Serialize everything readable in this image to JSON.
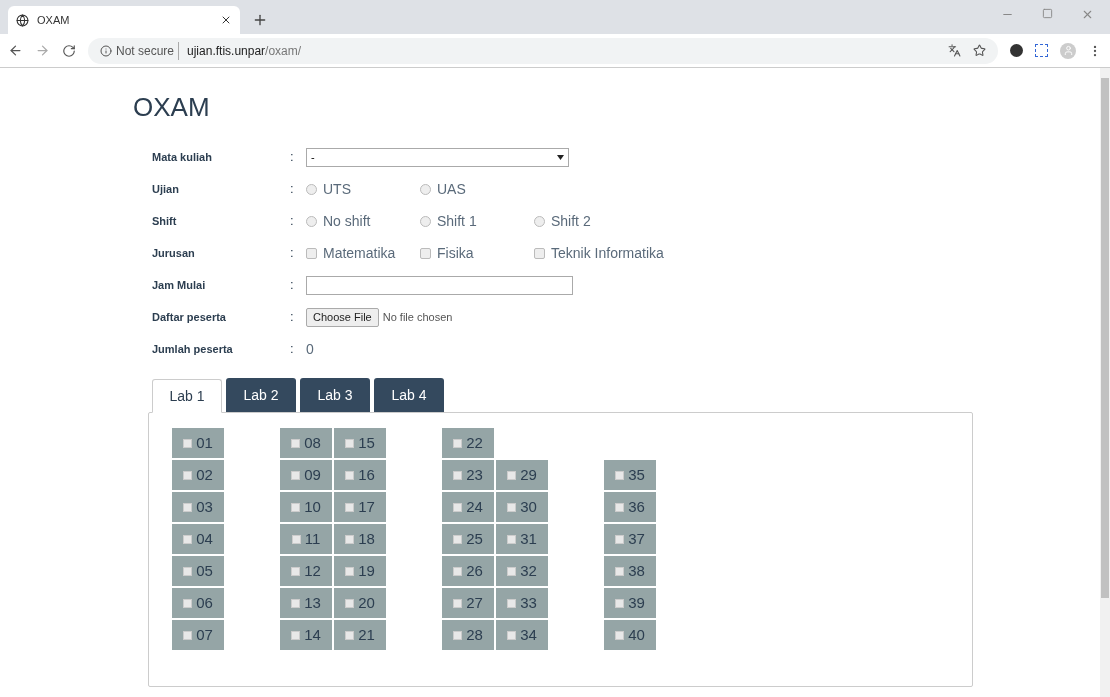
{
  "browser": {
    "tab_title": "OXAM",
    "security": "Not secure",
    "url_host": "ujian.ftis.unpar",
    "url_path": "/oxam/"
  },
  "page": {
    "title": "OXAM",
    "form": [
      {
        "kind": "select",
        "label": "Mata kuliah",
        "colon": ":",
        "value": "-"
      },
      {
        "kind": "radio",
        "label": "Ujian",
        "colon": ":",
        "options": [
          {
            "label": "UTS",
            "selected": false
          },
          {
            "label": "UAS",
            "selected": false
          }
        ]
      },
      {
        "kind": "radio",
        "label": "Shift",
        "colon": ":",
        "options": [
          {
            "label": "No shift",
            "selected": false
          },
          {
            "label": "Shift 1",
            "selected": false
          },
          {
            "label": "Shift 2",
            "selected": false
          }
        ]
      },
      {
        "kind": "checkbox",
        "label": "Jurusan",
        "colon": ":",
        "options": [
          {
            "label": "Matematika",
            "checked": false
          },
          {
            "label": "Fisika",
            "checked": false
          },
          {
            "label": "Teknik Informatika",
            "checked": false
          }
        ]
      },
      {
        "kind": "text",
        "label": "Jam Mulai",
        "colon": ":"
      },
      {
        "kind": "file",
        "label": "Daftar peserta",
        "colon": ":",
        "button": "Choose File",
        "status": "No file chosen"
      },
      {
        "kind": "value",
        "label": "Jumlah peserta",
        "colon": ":",
        "value": "0"
      }
    ],
    "tabs": [
      {
        "label": "Lab 1",
        "selected": true
      },
      {
        "label": "Lab 2",
        "selected": false
      },
      {
        "label": "Lab 3",
        "selected": false
      },
      {
        "label": "Lab 4",
        "selected": false
      }
    ],
    "seat_groups": [
      {
        "columns": [
          {
            "seats": [
              {
                "label": "01",
                "checked": false
              },
              {
                "label": "02",
                "checked": false
              },
              {
                "label": "03",
                "checked": false
              },
              {
                "label": "04",
                "checked": false
              },
              {
                "label": "05",
                "checked": false
              },
              {
                "label": "06",
                "checked": false
              },
              {
                "label": "07",
                "checked": false
              }
            ]
          }
        ]
      },
      {
        "columns": [
          {
            "seats": [
              {
                "label": "08",
                "checked": false
              },
              {
                "label": "09",
                "checked": false
              },
              {
                "label": "10",
                "checked": false
              },
              {
                "label": "11",
                "checked": false
              },
              {
                "label": "12",
                "checked": false
              },
              {
                "label": "13",
                "checked": false
              },
              {
                "label": "14",
                "checked": false
              }
            ]
          },
          {
            "seats": [
              {
                "label": "15",
                "checked": false
              },
              {
                "label": "16",
                "checked": false
              },
              {
                "label": "17",
                "checked": false
              },
              {
                "label": "18",
                "checked": false
              },
              {
                "label": "19",
                "checked": false
              },
              {
                "label": "20",
                "checked": false
              },
              {
                "label": "21",
                "checked": false
              }
            ]
          }
        ]
      },
      {
        "columns": [
          {
            "seats": [
              {
                "label": "22",
                "checked": false
              },
              {
                "label": "23",
                "checked": false
              },
              {
                "label": "24",
                "checked": false
              },
              {
                "label": "25",
                "checked": false
              },
              {
                "label": "26",
                "checked": false
              },
              {
                "label": "27",
                "checked": false
              },
              {
                "label": "28",
                "checked": false
              }
            ]
          },
          {
            "seats": [
              {
                "label": "29",
                "checked": false
              },
              {
                "label": "30",
                "checked": false
              },
              {
                "label": "31",
                "checked": false
              },
              {
                "label": "32",
                "checked": false
              },
              {
                "label": "33",
                "checked": false
              },
              {
                "label": "34",
                "checked": false
              }
            ]
          }
        ]
      },
      {
        "columns": [
          {
            "seats": [
              {
                "label": "35",
                "checked": false
              },
              {
                "label": "36",
                "checked": false
              },
              {
                "label": "37",
                "checked": false
              },
              {
                "label": "38",
                "checked": false
              },
              {
                "label": "39",
                "checked": false
              },
              {
                "label": "40",
                "checked": false
              }
            ]
          }
        ]
      }
    ]
  }
}
